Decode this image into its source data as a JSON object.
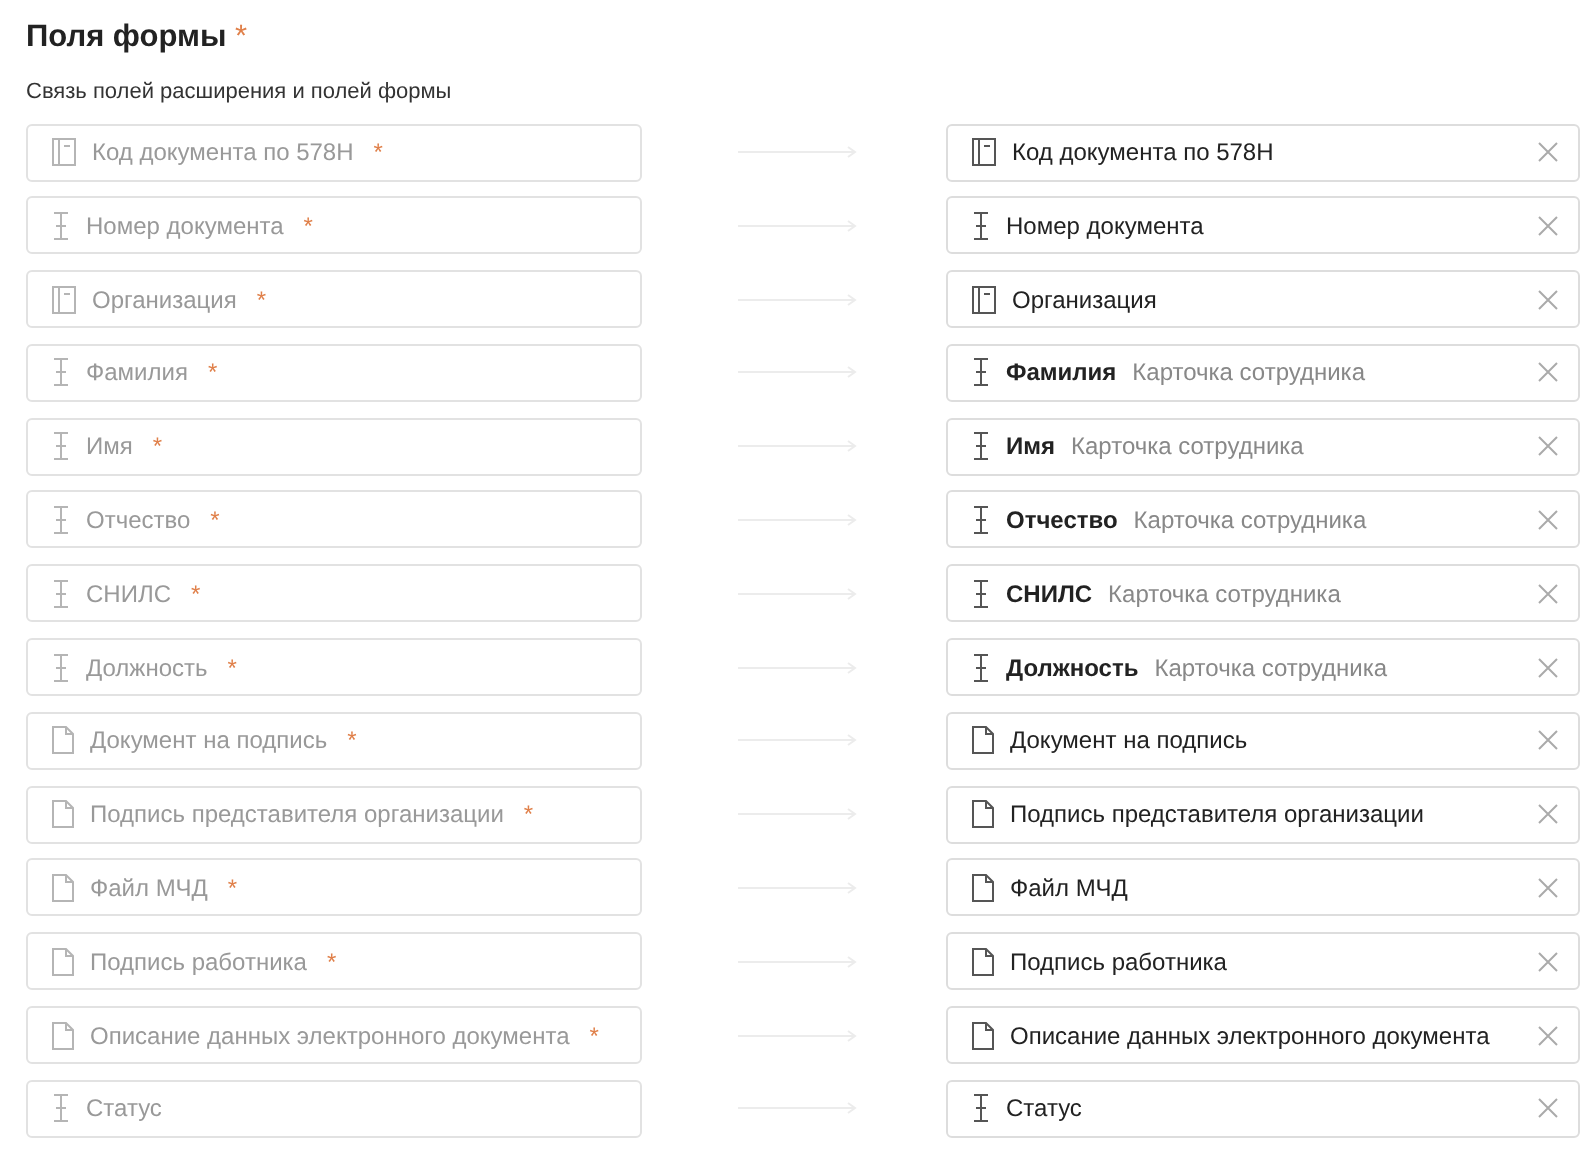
{
  "title": "Поля формы",
  "title_mark": "*",
  "subtitle": "Связь полей расширения и полей формы",
  "rows": [
    {
      "kind": "select",
      "field": "Код документа по 578Н",
      "required": true,
      "target": {
        "name": "Код документа по 578Н"
      }
    },
    {
      "kind": "text",
      "field": "Номер документа",
      "required": true,
      "target": {
        "name": "Номер документа"
      }
    },
    {
      "kind": "select",
      "field": "Организация",
      "required": true,
      "target": {
        "name": "Организация"
      }
    },
    {
      "kind": "text",
      "field": "Фамилия",
      "required": true,
      "target": {
        "name": "Фамилия",
        "source": "Карточка сотрудника"
      }
    },
    {
      "kind": "text",
      "field": "Имя",
      "required": true,
      "target": {
        "name": "Имя",
        "source": "Карточка сотрудника"
      }
    },
    {
      "kind": "text",
      "field": "Отчество",
      "required": true,
      "target": {
        "name": "Отчество",
        "source": "Карточка сотрудника"
      }
    },
    {
      "kind": "text",
      "field": "СНИЛС",
      "required": true,
      "target": {
        "name": "СНИЛС",
        "source": "Карточка сотрудника"
      }
    },
    {
      "kind": "text",
      "field": "Должность",
      "required": true,
      "target": {
        "name": "Должность",
        "source": "Карточка сотрудника"
      }
    },
    {
      "kind": "file",
      "field": "Документ на подпись",
      "required": true,
      "target": {
        "name": "Документ на подпись"
      }
    },
    {
      "kind": "file",
      "field": "Подпись представителя организации",
      "required": true,
      "target": {
        "name": "Подпись представителя организации"
      }
    },
    {
      "kind": "file",
      "field": "Файл МЧД",
      "required": true,
      "target": {
        "name": "Файл МЧД"
      }
    },
    {
      "kind": "file",
      "field": "Подпись работника",
      "required": true,
      "target": {
        "name": "Подпись работника"
      }
    },
    {
      "kind": "file",
      "field": "Описание данных электронного документа",
      "required": true,
      "target": {
        "name": "Описание данных электронного документа"
      }
    },
    {
      "kind": "text",
      "field": "Статус",
      "required": false,
      "target": {
        "name": "Статус"
      }
    }
  ]
}
